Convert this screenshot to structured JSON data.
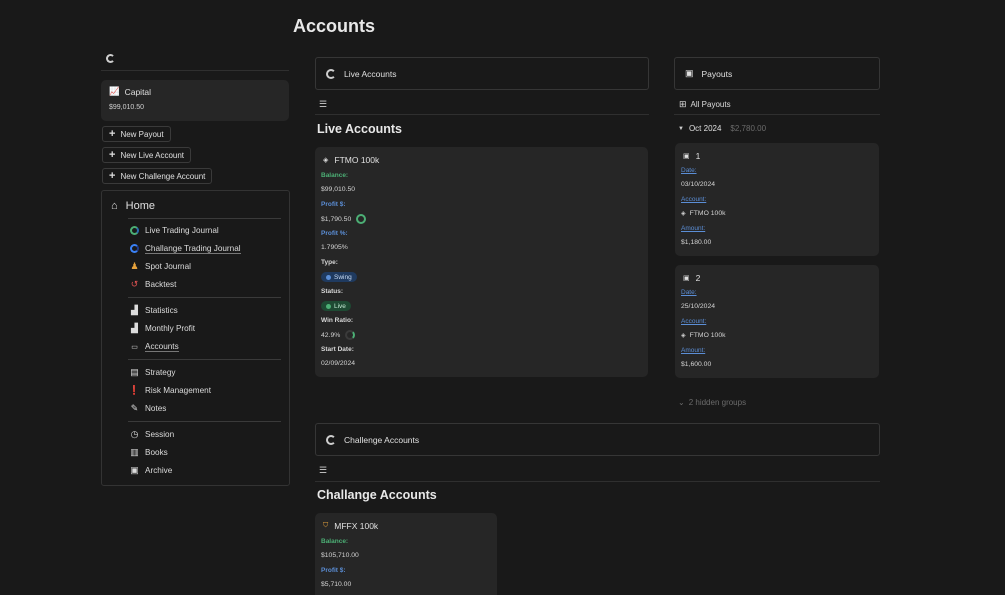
{
  "page": {
    "title": "Accounts"
  },
  "capital": {
    "label": "Capital",
    "value": "$99,010.50"
  },
  "actions": {
    "new_payout": "New Payout",
    "new_live": "New Live Account",
    "new_challenge": "New Challenge Account"
  },
  "nav": {
    "home": "Home",
    "items": [
      "Live Trading Journal",
      "Challange Trading Journal",
      "Spot Journal",
      "Backtest",
      "Statistics",
      "Monthly Profit",
      "Accounts",
      "Strategy",
      "Risk Management",
      "Notes",
      "Session",
      "Books",
      "Archive"
    ]
  },
  "live": {
    "header": "Live Accounts",
    "section": "Live Accounts",
    "card": {
      "name": "FTMO 100k",
      "balance_label": "Balance:",
      "balance": "$99,010.50",
      "profit_label": "Profit $:",
      "profit": "$1,790.50",
      "profit_pct_label": "Profit %:",
      "profit_pct": "1.7905%",
      "type_label": "Type:",
      "type": "Swing",
      "status_label": "Status:",
      "status": "Live",
      "win_label": "Win Ratio:",
      "win": "42.9%",
      "win_ratio_value": 0.429,
      "start_label": "Start Date:",
      "start": "02/09/2024"
    }
  },
  "payouts": {
    "header": "Payouts",
    "view": "All Payouts",
    "group": "Oct 2024",
    "group_total": "$2,780.00",
    "hidden": "2 hidden groups",
    "cards": [
      {
        "title": "1",
        "date_label": "Date:",
        "date": "03/10/2024",
        "account_label": "Account:",
        "account": "FTMO 100k",
        "amount_label": "Amount:",
        "amount": "$1,180.00"
      },
      {
        "title": "2",
        "date_label": "Date:",
        "date": "25/10/2024",
        "account_label": "Account:",
        "account": "FTMO 100k",
        "amount_label": "Amount:",
        "amount": "$1,600.00"
      }
    ]
  },
  "challenge": {
    "header": "Challenge Accounts",
    "section": "Challange Accounts",
    "card": {
      "name": "MFFX 100k",
      "balance_label": "Balance:",
      "balance": "$105,710.00",
      "profit_label": "Profit $:",
      "profit": "$5,710.00"
    }
  },
  "colors": {
    "bg": "#191919",
    "card": "#262626",
    "green": "#4caf75",
    "blue": "#5b8ed6"
  }
}
